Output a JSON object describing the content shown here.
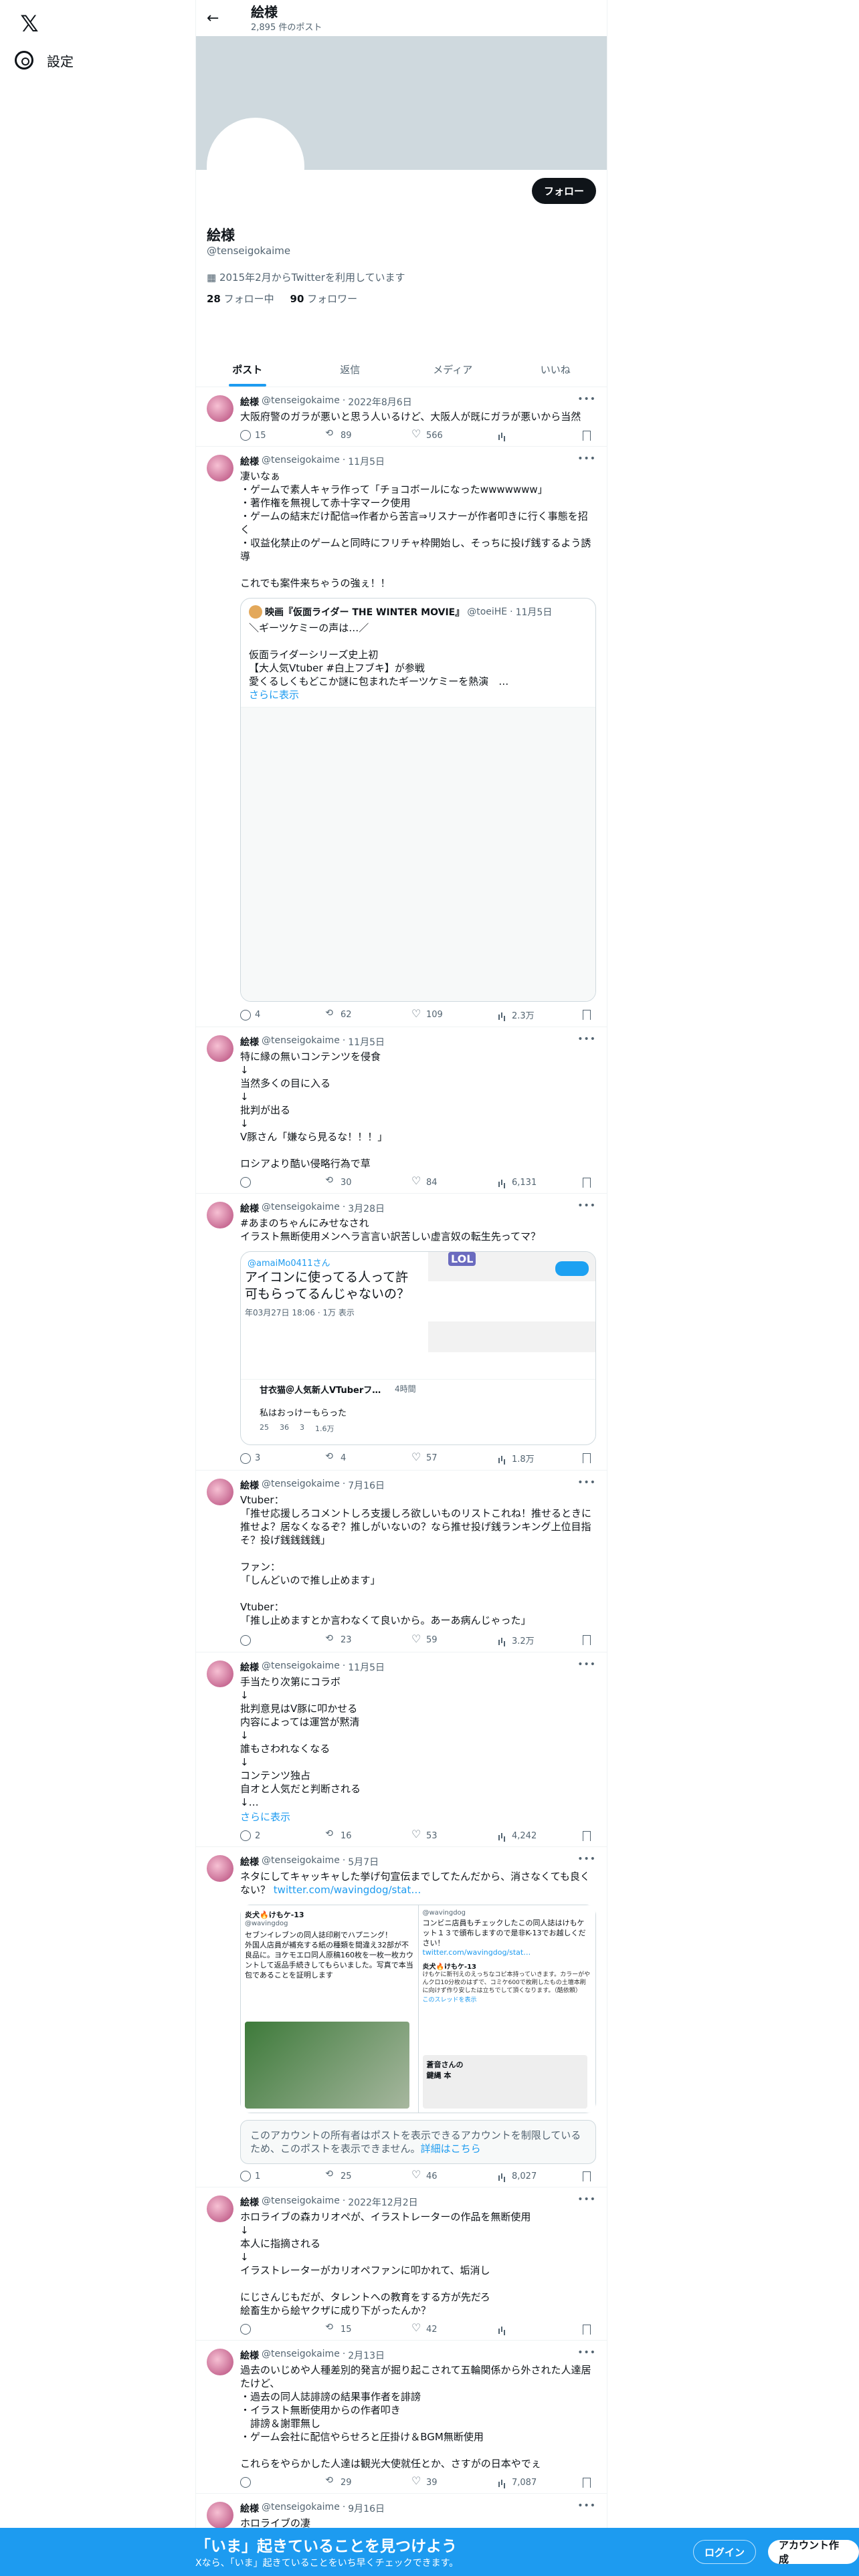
{
  "nav": {
    "settings_label": "設定"
  },
  "header": {
    "name": "絵様",
    "post_count": "2,895 件のポスト"
  },
  "profile": {
    "follow_label": "フォロー",
    "name": "絵様",
    "handle": "@tenseigokaime",
    "joined": "2015年2月からTwitterを利用しています",
    "following_count": "28",
    "following_label": "フォロー中",
    "followers_count": "90",
    "followers_label": "フォロワー"
  },
  "tabs": [
    "ポスト",
    "返信",
    "メディア",
    "いいね"
  ],
  "tweets": [
    {
      "name": "絵様",
      "handle": "@tenseigokaime",
      "date": "2022年8月6日",
      "text": "大阪府警のガラが悪いと思う人いるけど、大阪人が既にガラが悪いから当然",
      "reply": "15",
      "rt": "89",
      "like": "566",
      "views": ""
    },
    {
      "name": "絵様",
      "handle": "@tenseigokaime",
      "date": "11月5日",
      "text": "凄いなぁ\n・ゲームで素人キャラ作って「チョコボールになったwwwwwww」\n・著作権を無視して赤十字マーク使用\n・ゲームの結末だけ配信⇒作者から苦言⇒リスナーが作者叩きに行く事態を招く\n・収益化禁止のゲームと同時にフリチャ枠開始し、そっちに投げ銭するよう誘導\n\nこれでも案件来ちゃうの強ぇ！！",
      "reply": "4",
      "rt": "62",
      "like": "109",
      "views": "2.3万",
      "quote": {
        "name": "映画『仮面ライダー THE WINTER MOVIE』",
        "handle": "@toeiHE",
        "date": "11月5日",
        "text": "＼ギーツケミーの声は…／\n\n仮面ライダーシリーズ史上初\n【大人気Vtuber #白上フブキ】が参戦\n愛くるしくもどこか謎に包まれたギーツケミーを熱演　…",
        "more": "さらに表示"
      }
    },
    {
      "name": "絵様",
      "handle": "@tenseigokaime",
      "date": "11月5日",
      "text": "特に縁の無いコンテンツを侵食\n↓\n当然多くの目に入る\n↓\n批判が出る\n↓\nV豚さん「嫌なら見るな！！！」\n\nロシアより酷い侵略行為で草",
      "reply": "",
      "rt": "30",
      "like": "84",
      "views": "6,131"
    },
    {
      "name": "絵様",
      "handle": "@tenseigokaime",
      "date": "3月28日",
      "text": "#あまのちゃんにみせなされ\nイラスト無断使用メンヘラ言言い訳苦しい虚言奴の転生先ってマ？",
      "reply": "3",
      "rt": "4",
      "like": "57",
      "views": "1.8万",
      "media": {
        "mention": "@amaiMo0411さん",
        "title": "アイコンに使ってる人って許可もらってるんじゃないの？",
        "date": "年03月27日 18:06 · 1万 表示",
        "sub_name": "甘衣猫＠人気新人VTuberフ…",
        "sub_date": "4時間",
        "sub_text": "私はおっけーもらった",
        "s_reply": "25",
        "s_rt": "36",
        "s_like": "3",
        "s_views": "1.6万",
        "lol": "LOL"
      }
    },
    {
      "name": "絵様",
      "handle": "@tenseigokaime",
      "date": "7月16日",
      "text": "Vtuber：\n「推せ応援しろコメントしろ支援しろ欲しいものリストこれね！推せるときに推せよ？居なくなるぞ？推しがいないの？なら推せ投げ銭ランキング上位目指そ？投げ銭銭銭銭」\n\nファン：\n「しんどいので推し止めます」\n\nVtuber：\n「推し止めますとか言わなくて良いから。あーあ病んじゃった」",
      "reply": "",
      "rt": "23",
      "like": "59",
      "views": "3.2万"
    },
    {
      "name": "絵様",
      "handle": "@tenseigokaime",
      "date": "11月5日",
      "text": "手当たり次第にコラボ\n↓\n批判意見はV豚に叩かせる\n内容によっては運営が黙清\n↓\n誰もさわれなくなる\n↓\nコンテンツ独占\n自オと人気だと判断される\n↓…",
      "more": "さらに表示",
      "reply": "2",
      "rt": "16",
      "like": "53",
      "views": "4,242"
    },
    {
      "name": "絵様",
      "handle": "@tenseigokaime",
      "date": "5月7日",
      "text": "ネタにしてキャッキャした挙げ句宣伝までしてたんだから、消さなくても良くない？",
      "link": "twitter.com/wavingdog/stat…",
      "reply": "1",
      "rt": "25",
      "like": "46",
      "views": "8,027",
      "left_card": {
        "name": "炎犬🔥けもケ-13",
        "handle": "@wavingdog",
        "text": "セブンイレブンの同人誌印刷でハプニング！\n外国人店員が補充する紙の種類を間違え32部が不良品に。ヨケモエロ同人原稿160枚を一枚一枚カウントして返品手続きしてもらいました。写真で本当包であることを証明します"
      },
      "right_card": {
        "handle": "@wavingdog",
        "text": "コンビニ店員もチェックしたこの同人誌はけもケット１３で頒布しますので是非K-13でお越しください！",
        "link": "twitter.com/wavingdog/stat…",
        "inner_name": "炎犬🔥けもケ-13",
        "inner_text": "けもケに新刊えのえっちなコピ本持っていきます。カラーがやんクロ10分枚のはずで、コミケ600で枚刷したもの土壇本刷に向けず作り安したは立ちでして頂くなります。（酷依頼）",
        "thread": "このスレッドを表示",
        "book": "蒼音さんの\n鍵縄 本"
      },
      "notice": "このアカウントの所有者はポストを表示できるアカウントを制限しているため、このポストを表示できません。",
      "notice_link": "詳細はこちら"
    },
    {
      "name": "絵様",
      "handle": "@tenseigokaime",
      "date": "2022年12月2日",
      "text": "ホロライブの森カリオペが、イラストレーターの作品を無断使用\n↓\n本人に指摘される\n↓\nイラストレーターがカリオペファンに叩かれて、垢消し\n\nにじさんじもだが、タレントへの教育をする方が先だろ\n絵畜生から絵ヤクザに成り下がったんか？",
      "reply": "",
      "rt": "15",
      "like": "42",
      "views": ""
    },
    {
      "name": "絵様",
      "handle": "@tenseigokaime",
      "date": "2月13日",
      "text": "過去のいじめや人種差別的発言が掘り起こされて五輪関係から外された人達居たけど、\n・過去の同人誌誹謗の結果事作者を誹謗\n・イラスト無断使用からの作者叩き\n　誹謗＆謝罪無し\n・ゲーム会社に配信やらせろと圧掛け＆BGM無断使用\n\nこれらをやらかした人達は観光大使就任とか、さすがの日本やでぇ",
      "reply": "",
      "rt": "29",
      "like": "39",
      "views": "7,087"
    },
    {
      "name": "絵様",
      "handle": "@tenseigokaime",
      "date": "9月16日",
      "text": "ホロライブの凄",
      "reply": "",
      "rt": "",
      "like": "",
      "views": ""
    }
  ],
  "bottom": {
    "title": "「いま」起きていることを見つけよう",
    "subtitle": "Xなら、「いま」起きていることをいち早くチェックできます。",
    "login": "ログイン",
    "signup": "アカウント作成"
  }
}
